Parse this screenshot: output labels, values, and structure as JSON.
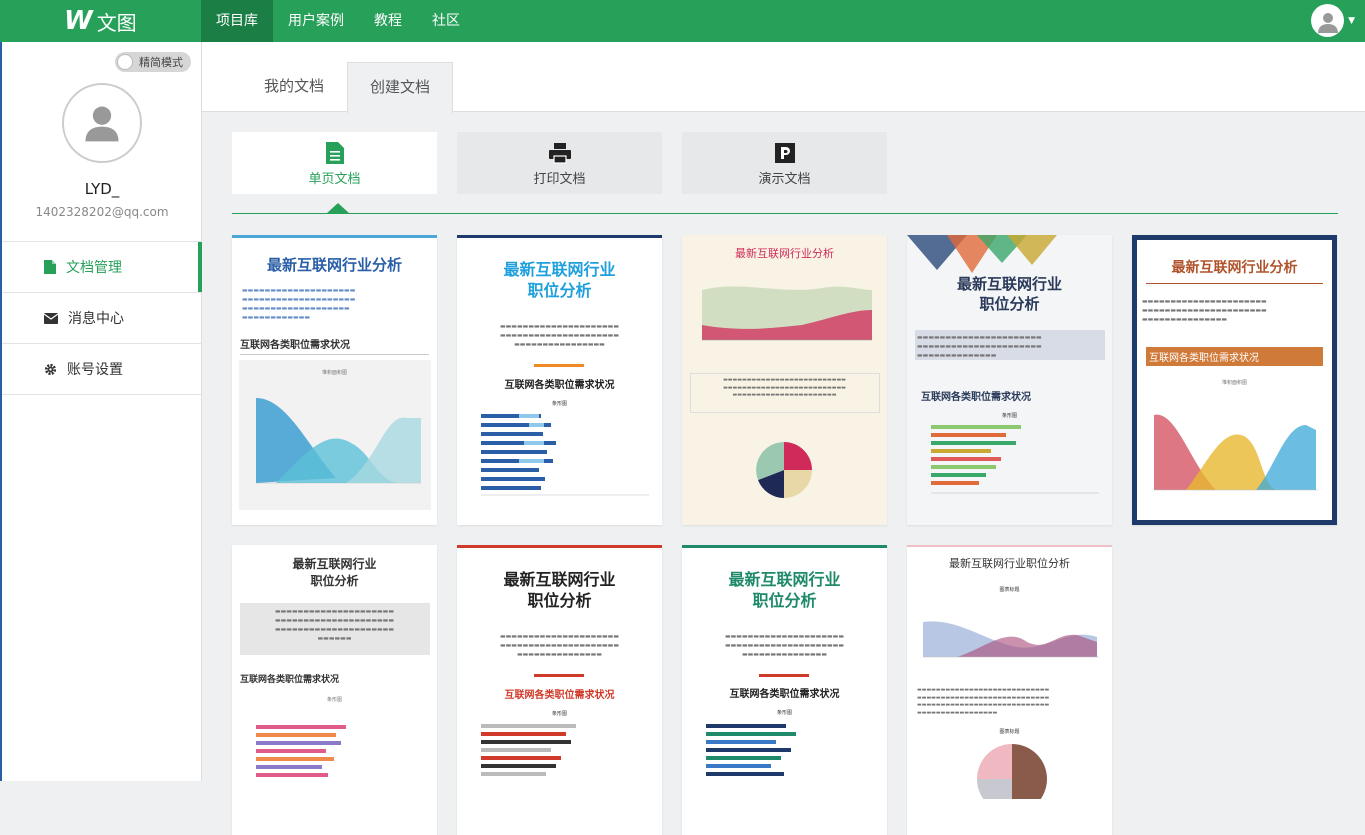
{
  "app": {
    "logo_letter": "W",
    "logo_text": "文图"
  },
  "nav": {
    "items": [
      "项目库",
      "用户案例",
      "教程",
      "社区"
    ],
    "active": 0
  },
  "sidebar": {
    "mode_label": "精简模式",
    "user_name": "LYD_",
    "user_email": "1402328202@qq.com",
    "menu": [
      {
        "label": "文档管理",
        "icon": "document-icon"
      },
      {
        "label": "消息中心",
        "icon": "envelope-icon"
      },
      {
        "label": "账号设置",
        "icon": "gear-icon"
      }
    ]
  },
  "tabs": [
    "我的文档",
    "创建文档"
  ],
  "doc_types": [
    {
      "label": "单页文档",
      "icon": "document-icon"
    },
    {
      "label": "打印文档",
      "icon": "printer-icon"
    },
    {
      "label": "演示文档",
      "icon": "presentation-icon"
    }
  ],
  "templates": [
    {
      "title": "最新互联网行业分析",
      "subtitle": "互联网各类职位需求状况",
      "chart_title": "堆积面积图"
    },
    {
      "title1": "最新互联网行业",
      "title2": "职位分析",
      "subtitle": "互联网各类职位需求状况",
      "chart_title": "条形图"
    },
    {
      "title": "最新互联网行业分析"
    },
    {
      "title1": "最新互联网行业",
      "title2": "职位分析",
      "subtitle": "互联网各类职位需求状况",
      "chart_title": "条形图"
    },
    {
      "title": "最新互联网行业分析",
      "subtitle": "互联网各类职位需求状况",
      "chart_title": "堆积面积图"
    },
    {
      "title1": "最新互联网行业",
      "title2": "职位分析",
      "subtitle": "互联网各类职位需求状况",
      "chart_title": "条形图"
    },
    {
      "title1": "最新互联网行业",
      "title2": "职位分析",
      "subtitle": "互联网各类职位需求状况",
      "chart_title": "条形图"
    },
    {
      "title1": "最新互联网行业",
      "title2": "职位分析",
      "subtitle": "互联网各类职位需求状况",
      "chart_title": "条形图"
    },
    {
      "title": "最新互联网行业职位分析",
      "chart_title": "图表标题",
      "chart_title2": "图表标题"
    }
  ],
  "colors": {
    "primary": "#27a05a",
    "primary_dark": "#1b7f45",
    "accent_blue": "#2a5fa8"
  }
}
